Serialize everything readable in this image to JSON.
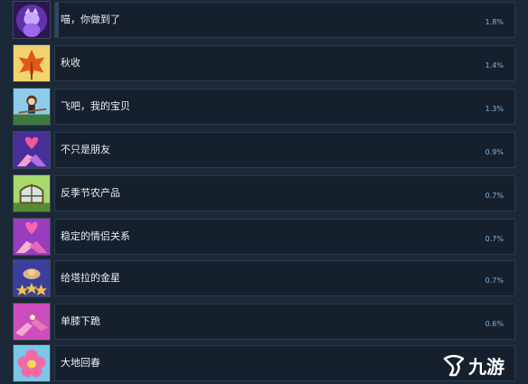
{
  "achievements": [
    {
      "name": "喵，你做到了",
      "percent": "1.8%",
      "icon": "purple-cat-icon",
      "colors": [
        "#3c1c6e",
        "#a05ce6"
      ]
    },
    {
      "name": "秋收",
      "percent": "1.4%",
      "icon": "autumn-leaf-icon",
      "colors": [
        "#f3d56a",
        "#e0521e"
      ]
    },
    {
      "name": "飞吧，我的宝贝",
      "percent": "1.3%",
      "icon": "flying-witch-icon",
      "colors": [
        "#7fc3e8",
        "#2f6a3b"
      ]
    },
    {
      "name": "不只是朋友",
      "percent": "0.9%",
      "icon": "heart-hands-icon",
      "colors": [
        "#5d3fb0",
        "#e54b8e"
      ]
    },
    {
      "name": "反季节农产品",
      "percent": "0.7%",
      "icon": "greenhouse-icon",
      "colors": [
        "#9fd36a",
        "#6b4a2b"
      ]
    },
    {
      "name": "稳定的情侣关系",
      "percent": "0.7%",
      "icon": "heart-hands-icon",
      "colors": [
        "#a33fbf",
        "#ef5aa3"
      ]
    },
    {
      "name": "给塔拉的金星",
      "percent": "0.7%",
      "icon": "gold-stars-icon",
      "colors": [
        "#3a3f9e",
        "#f4c542"
      ]
    },
    {
      "name": "单膝下跪",
      "percent": "0.6%",
      "icon": "proposal-hands-icon",
      "colors": [
        "#d34ec0",
        "#f07ab4"
      ]
    },
    {
      "name": "大地回春",
      "percent": "",
      "icon": "flower-icon",
      "colors": [
        "#4fb7e8",
        "#f06aa7"
      ]
    }
  ],
  "watermark": {
    "text": "九游"
  }
}
